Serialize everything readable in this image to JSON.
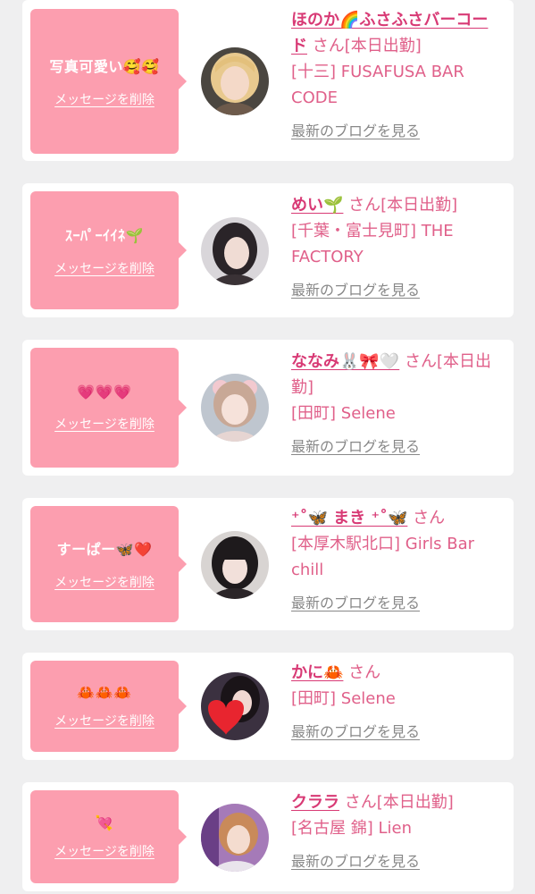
{
  "items": [
    {
      "message": "写真可愛い🥰🥰",
      "delete_label": "メッセージを削除",
      "name": "ほのか🌈ふさふさバーコード",
      "suffix": "さん[本日出勤]",
      "shop": "[十三] FUSAFUSA BAR CODE",
      "blog_label": "最新のブログを見る"
    },
    {
      "message": "ｽｰﾊﾟｰｲｲﾈ🌱",
      "delete_label": "メッセージを削除",
      "name": "めい🌱",
      "suffix": "さん[本日出勤]",
      "shop": "[千葉・富士見町] THE FACTORY",
      "blog_label": "最新のブログを見る"
    },
    {
      "message": "💗💗💗",
      "delete_label": "メッセージを削除",
      "name": "ななみ🐰🎀🤍",
      "suffix": "さん[本日出勤]",
      "shop": "[田町] Selene",
      "blog_label": "最新のブログを見る"
    },
    {
      "message": "すーぱー🦋❤️",
      "delete_label": "メッセージを削除",
      "name": "⁺˚🦋 まき ⁺˚🦋",
      "suffix": "さん",
      "shop": "[本厚木駅北口] Girls Bar chill",
      "blog_label": "最新のブログを見る"
    },
    {
      "message": "🦀🦀🦀",
      "delete_label": "メッセージを削除",
      "name": "かに🦀",
      "suffix": "さん",
      "shop": "[田町] Selene",
      "blog_label": "最新のブログを見る"
    },
    {
      "message": "💘",
      "delete_label": "メッセージを削除",
      "name": "クララ",
      "suffix": "さん[本日出勤]",
      "shop": "[名古屋 錦] Lien",
      "blog_label": "最新のブログを見る"
    }
  ],
  "colors": {
    "background": "#efeff0",
    "card": "#ffffff",
    "bubble": "#fc9eaf",
    "name": "#d83a75",
    "shop": "#e0608a",
    "blog_link": "#888888"
  }
}
